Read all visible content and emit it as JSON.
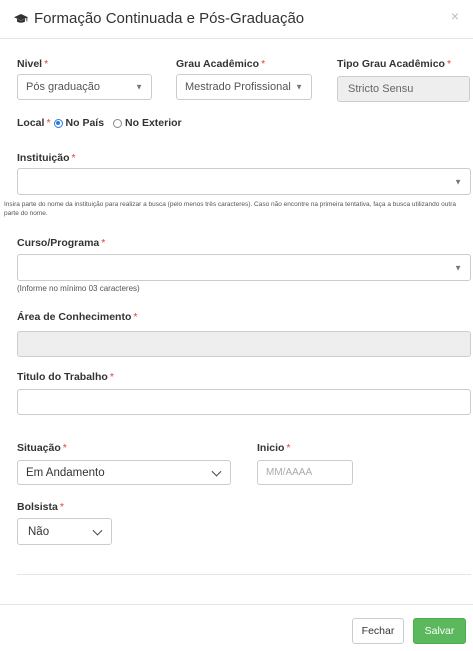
{
  "modal": {
    "title": "Formação Continuada e Pós-Graduação",
    "close_glyph": "×"
  },
  "form": {
    "nivel": {
      "label": "Nivel",
      "value": "Pós graduação"
    },
    "grau": {
      "label": "Grau Acadêmico",
      "value": "Mestrado Profissional"
    },
    "tipo_grau": {
      "label": "Tipo Grau Acadêmico",
      "value": "Stricto Sensu"
    },
    "local": {
      "label": "Local",
      "option_pais": "No País",
      "option_exterior": "No Exterior",
      "selected": "No País"
    },
    "instituicao": {
      "label": "Instituição",
      "value": "",
      "help": "Insira parte do nome da instituição para realizar a busca (pelo menos três caracteres). Caso não encontre na primeira tentativa, faça a busca utilizando outra parte do nome."
    },
    "curso": {
      "label": "Curso/Programa",
      "value": "",
      "help": "(Informe no mínimo 03 caracteres)"
    },
    "area": {
      "label": "Área de Conhecimento",
      "value": ""
    },
    "titulo": {
      "label": "Titulo do Trabalho",
      "value": ""
    },
    "situacao": {
      "label": "Situação",
      "value": "Em Andamento"
    },
    "inicio": {
      "label": "Inicio",
      "placeholder": "MM/AAAA"
    },
    "bolsista": {
      "label": "Bolsista",
      "value": "Não"
    },
    "required_mark": "*"
  },
  "footer": {
    "close_label": "Fechar",
    "save_label": "Salvar"
  },
  "icons": {
    "graduation_cap": "graduation-cap-icon"
  },
  "colors": {
    "save_button": "#5cb85c",
    "required": "#e04040",
    "radio_selected": "#2a7ae2"
  }
}
